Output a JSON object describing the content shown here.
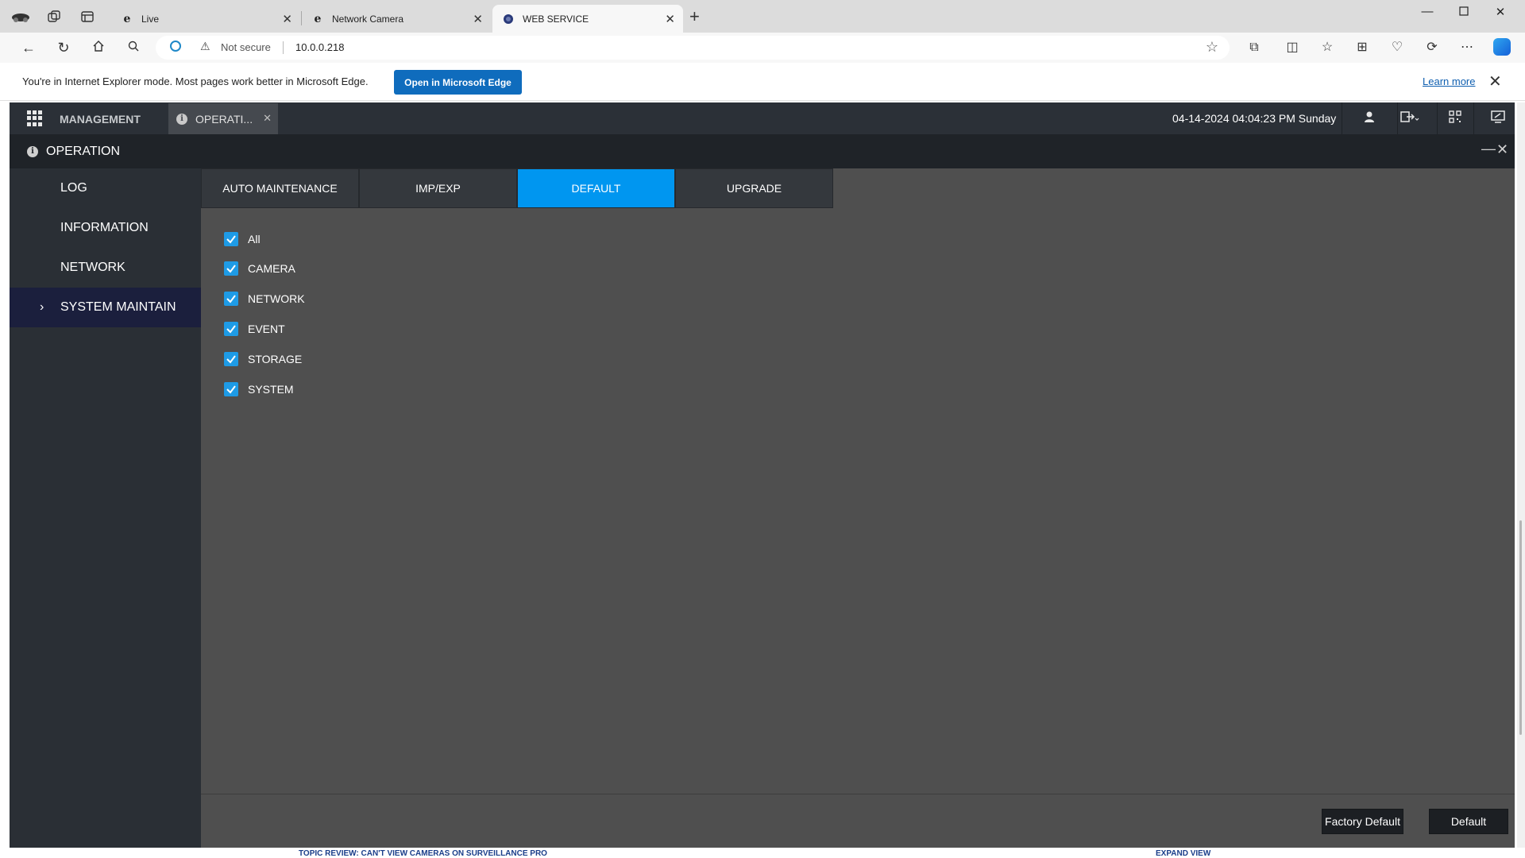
{
  "browser": {
    "tabs": [
      {
        "title": "Live",
        "icon": "ie-icon"
      },
      {
        "title": "Network Camera",
        "icon": "ie-icon"
      },
      {
        "title": "WEB SERVICE",
        "icon": "globe-icon"
      }
    ],
    "address": {
      "security_label": "Not secure",
      "url": "10.0.0.218"
    },
    "ie_bar": {
      "message": "You're in Internet Explorer mode. Most pages work better in Microsoft Edge.",
      "open_button": "Open in Microsoft Edge",
      "learn_more": "Learn more"
    }
  },
  "app": {
    "management_label": "MANAGEMENT",
    "open_tab_label": "OPERATI...",
    "datetime": "04-14-2024 04:04:23 PM Sunday",
    "header_title": "OPERATION",
    "sidebar": [
      {
        "label": "LOG",
        "active": false
      },
      {
        "label": "INFORMATION",
        "active": false
      },
      {
        "label": "NETWORK",
        "active": false
      },
      {
        "label": "SYSTEM MAINTAIN",
        "active": true
      }
    ],
    "tabs": [
      {
        "label": "AUTO MAINTENANCE",
        "active": false
      },
      {
        "label": "IMP/EXP",
        "active": false
      },
      {
        "label": "DEFAULT",
        "active": true
      },
      {
        "label": "UPGRADE",
        "active": false
      }
    ],
    "checkboxes": [
      {
        "label": "All",
        "checked": true
      },
      {
        "label": "CAMERA",
        "checked": true
      },
      {
        "label": "NETWORK",
        "checked": true
      },
      {
        "label": "EVENT",
        "checked": true
      },
      {
        "label": "STORAGE",
        "checked": true
      },
      {
        "label": "SYSTEM",
        "checked": true
      }
    ],
    "buttons": {
      "factory_default": "Factory Default",
      "default": "Default"
    }
  },
  "below_page": {
    "left_text": "TOPIC REVIEW: CAN'T VIEW CAMERAS ON SURVEILLANCE PRO",
    "right_text": "EXPAND VIEW"
  },
  "colors": {
    "accent": "#0096f0",
    "checkbox": "#1e9be6",
    "sidebar_active": "#1b1f3d"
  }
}
